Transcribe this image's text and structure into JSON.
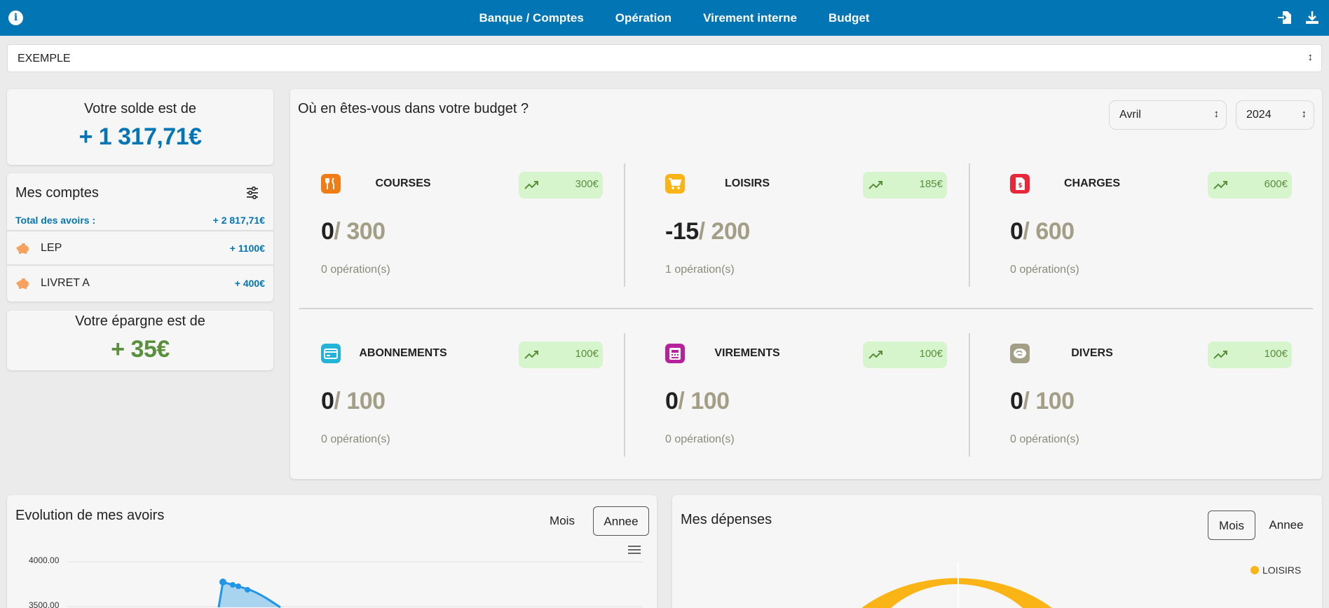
{
  "nav": {
    "items": [
      "Banque / Comptes",
      "Opération",
      "Virement interne",
      "Budget"
    ]
  },
  "account_select": {
    "value": "EXEMPLE"
  },
  "solde": {
    "title": "Votre solde est de",
    "value": "+ 1 317,71€"
  },
  "comptes": {
    "title": "Mes comptes",
    "total_label": "Total des avoirs :",
    "total_value": "+ 2 817,71€",
    "items": [
      {
        "name": "LEP",
        "amount": "+ 1100€"
      },
      {
        "name": "LIVRET A",
        "amount": "+ 400€"
      }
    ]
  },
  "epargne": {
    "title": "Votre épargne est de",
    "value": "+ 35€"
  },
  "budget": {
    "title": "Où en êtes-vous dans votre budget ?",
    "month": "Avril",
    "year": "2024",
    "categories": [
      {
        "name": "COURSES",
        "icon": "utensils-icon",
        "color": "#f07c15",
        "trend": "300€",
        "spent": "0",
        "budget": "/ 300",
        "ops": "0 opération(s)"
      },
      {
        "name": "LOISIRS",
        "icon": "cart-icon",
        "color": "#fbb416",
        "trend": "185€",
        "spent": "-15",
        "budget": "/ 200",
        "ops": "1 opération(s)"
      },
      {
        "name": "CHARGES",
        "icon": "invoice-icon",
        "color": "#e8273b",
        "trend": "600€",
        "spent": "0",
        "budget": "/ 600",
        "ops": "0 opération(s)"
      },
      {
        "name": "ABONNEMENTS",
        "icon": "card-icon",
        "color": "#23b3d6",
        "trend": "100€",
        "spent": "0",
        "budget": "/ 100",
        "ops": "0 opération(s)"
      },
      {
        "name": "VIREMENTS",
        "icon": "atm-icon",
        "color": "#b8219c",
        "trend": "100€",
        "spent": "0",
        "budget": "/ 100",
        "ops": "0 opération(s)"
      },
      {
        "name": "DIVERS",
        "icon": "misc-icon",
        "color": "#a39f87",
        "trend": "100€",
        "spent": "0",
        "budget": "/ 100",
        "ops": "0 opération(s)"
      }
    ]
  },
  "evolution": {
    "title": "Evolution de mes avoirs",
    "toggle_mois": "Mois",
    "toggle_annee": "Annee",
    "y_ticks": [
      "4000.00",
      "3500.00"
    ]
  },
  "depenses": {
    "title": "Mes dépenses",
    "toggle_mois": "Mois",
    "toggle_annee": "Annee",
    "legend": "LOISIRS",
    "legend_color": "#fbb416"
  }
}
